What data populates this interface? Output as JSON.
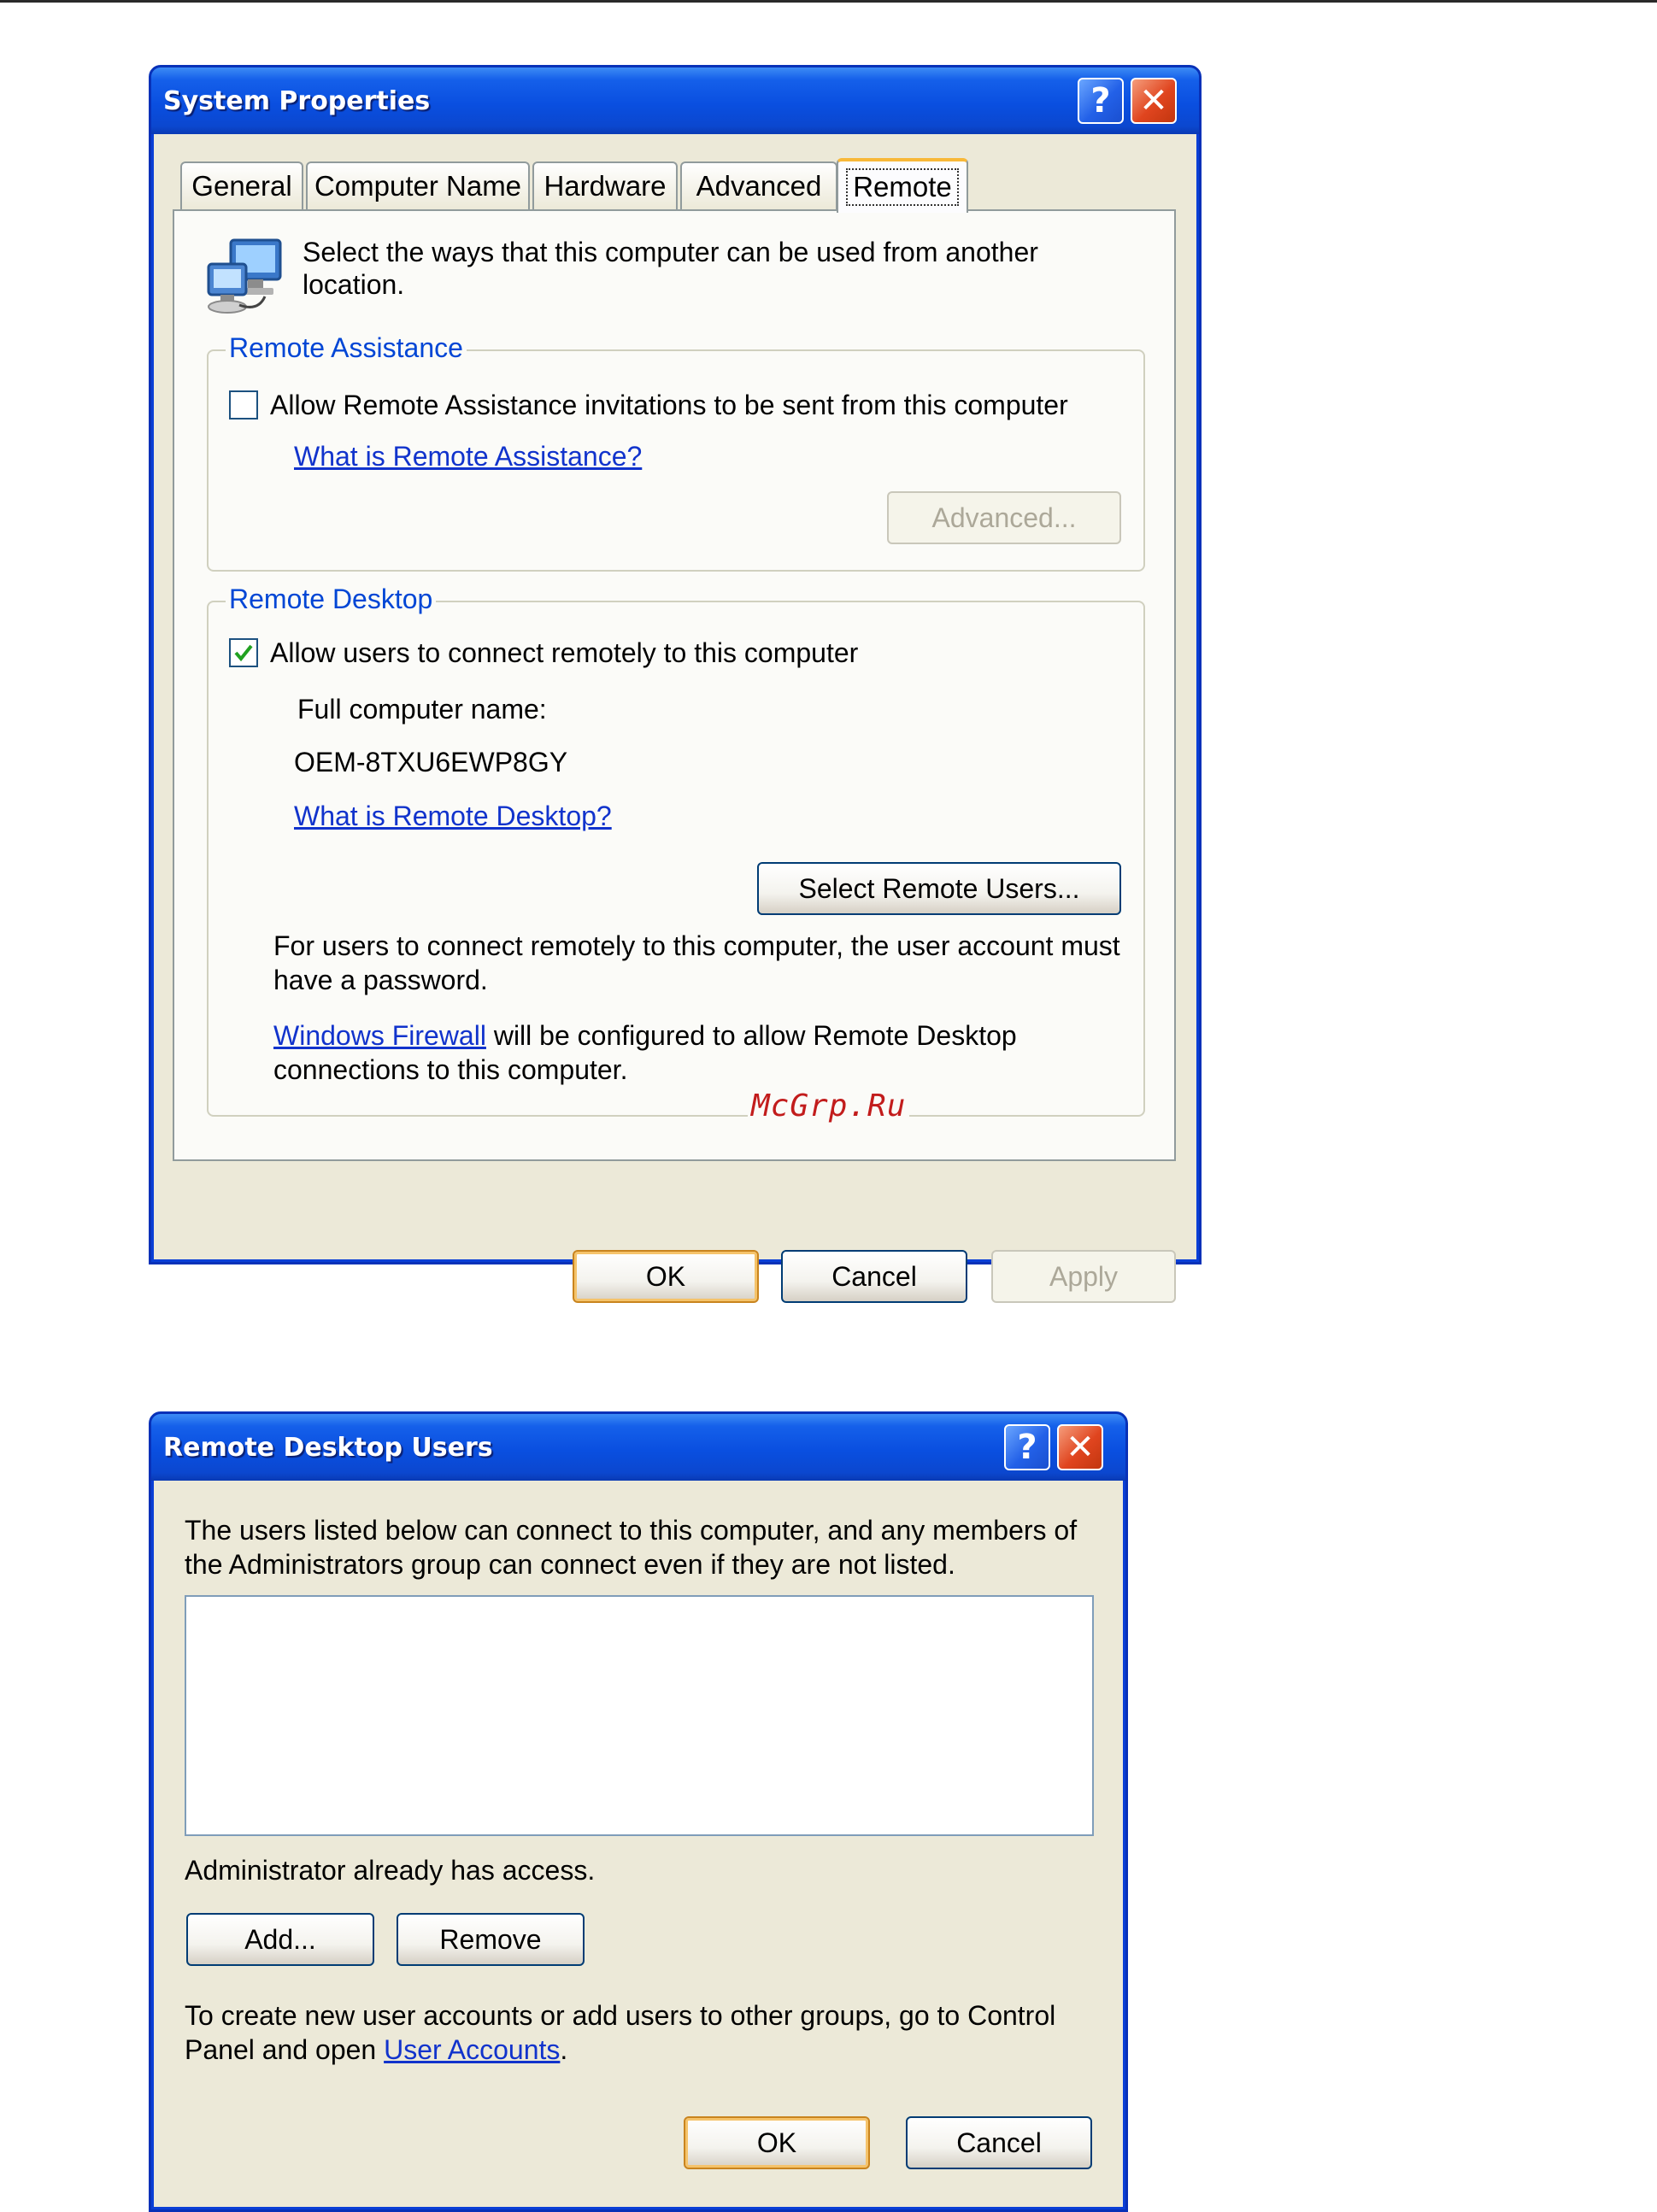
{
  "system_properties": {
    "title": "System Properties",
    "help_glyph": "?",
    "close_glyph": "✕",
    "tabs": [
      {
        "label": "General"
      },
      {
        "label": "Computer Name"
      },
      {
        "label": "Hardware"
      },
      {
        "label": "Advanced"
      },
      {
        "label": "Remote"
      }
    ],
    "active_tab": "Remote",
    "intro_line1": "Select the ways that this computer can be used from another",
    "intro_line2": "location.",
    "remote_assistance": {
      "group_label": "Remote Assistance",
      "checkbox_label": "Allow Remote Assistance invitations to be sent from this computer",
      "checked": false,
      "help_link": "What is Remote Assistance?",
      "advanced_button": "Advanced..."
    },
    "remote_desktop": {
      "group_label": "Remote Desktop",
      "checkbox_label": "Allow users to connect remotely to this computer",
      "checked": true,
      "full_name_label": "Full computer name:",
      "full_name_value": "OEM-8TXU6EWP8GY",
      "help_link": "What is Remote Desktop?",
      "select_users_button": "Select Remote Users...",
      "note_line1": "For users to connect remotely to this computer, the user account must",
      "note_line2": "have a password.",
      "firewall_link": "Windows Firewall",
      "firewall_line1_rest": " will be configured to allow Remote Desktop",
      "firewall_line2": "connections to this computer."
    },
    "buttons": {
      "ok": "OK",
      "cancel": "Cancel",
      "apply": "Apply"
    }
  },
  "watermark": "McGrp.Ru",
  "remote_desktop_users": {
    "title": "Remote Desktop Users",
    "help_glyph": "?",
    "close_glyph": "✕",
    "intro_line1": "The users listed below can connect to this computer, and any members of",
    "intro_line2": "the Administrators group can connect even if they are not listed.",
    "users": [],
    "access_note": "Administrator already has access.",
    "add_button": "Add...",
    "remove_button": "Remove",
    "footer_line1": "To create new user accounts or add users to other groups, go to Control",
    "footer_line2_prefix": "Panel and open ",
    "footer_link": "User Accounts",
    "footer_line2_suffix": ".",
    "buttons": {
      "ok": "OK",
      "cancel": "Cancel"
    }
  },
  "colors": {
    "titlebar": "#0a4fe0",
    "dialog_face": "#ece9d8",
    "group_label": "#0046d5",
    "link": "#1133cc",
    "default_button_border": "#c9841e",
    "watermark": "#c21c1c"
  }
}
